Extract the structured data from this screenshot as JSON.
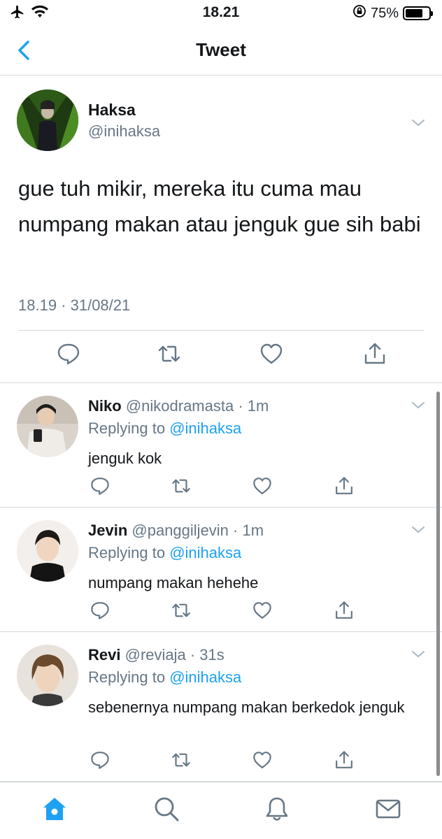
{
  "status_bar": {
    "time": "18.21",
    "battery_text": "75%",
    "battery_level": 0.75,
    "icons": [
      "airplane-icon",
      "wifi-icon",
      "orientation-lock-icon",
      "battery-icon"
    ]
  },
  "header": {
    "title": "Tweet",
    "back_icon": "chevron-left-icon"
  },
  "colors": {
    "accent": "#1da1f2",
    "secondary_text": "#657786",
    "divider": "#d4d7da"
  },
  "main_tweet": {
    "name": "Haksa",
    "handle": "@inihaksa",
    "text": "gue tuh mikir, mereka itu cuma mau numpang makan atau jenguk gue sih babi",
    "timestamp": "18.19 · 31/08/21",
    "actions": [
      "reply-icon",
      "retweet-icon",
      "like-icon",
      "share-icon"
    ]
  },
  "replies": [
    {
      "name": "Niko",
      "meta": "@nikodramasta · 1m",
      "replying_prefix": "Replying to ",
      "replying_to": "@inihaksa",
      "text": "jenguk kok"
    },
    {
      "name": "Jevin",
      "meta": "@panggiljevin · 1m",
      "replying_prefix": "Replying to ",
      "replying_to": "@inihaksa",
      "text": "numpang makan hehehe"
    },
    {
      "name": "Revi",
      "meta": "@reviaja · 31s",
      "replying_prefix": "Replying to ",
      "replying_to": "@inihaksa",
      "text": "sebenernya numpang makan berkedok jenguk"
    }
  ],
  "tab_bar": {
    "items": [
      "home-icon",
      "search-icon",
      "notifications-icon",
      "messages-icon"
    ],
    "active": "home-icon"
  }
}
